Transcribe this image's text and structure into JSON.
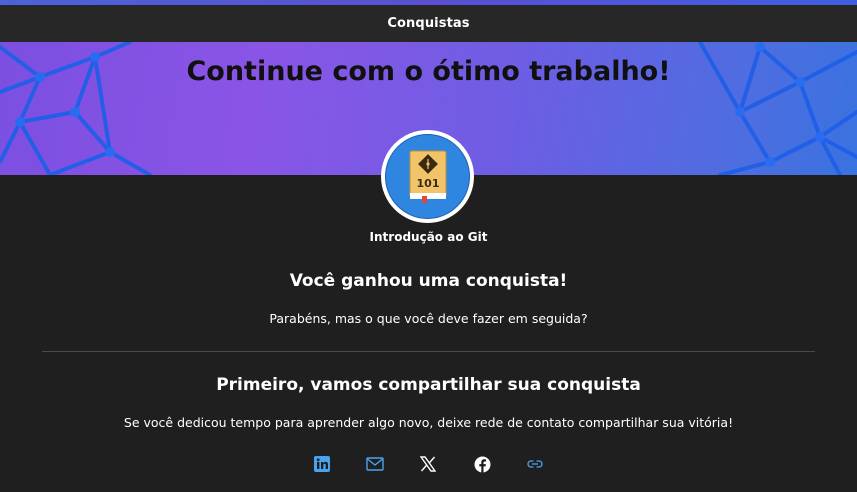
{
  "window": {
    "title": "Conquistas"
  },
  "banner": {
    "heading": "Continue com o ótimo trabalho!"
  },
  "badge": {
    "icon": "git-book-101-icon",
    "icon_text": "101",
    "title": "Introdução ao Git"
  },
  "earned": {
    "heading": "Você ganhou uma conquista!",
    "text": "Parabéns, mas o que você deve fazer em seguida?"
  },
  "share": {
    "heading": "Primeiro, vamos compartilhar sua conquista",
    "text": "Se você dedicou tempo para aprender algo novo, deixe rede de contato compartilhar sua vitória!",
    "buttons": [
      {
        "name": "linkedin",
        "icon": "linkedin-icon"
      },
      {
        "name": "email",
        "icon": "mail-icon"
      },
      {
        "name": "x",
        "icon": "x-icon"
      },
      {
        "name": "facebook",
        "icon": "facebook-icon"
      },
      {
        "name": "copy-link",
        "icon": "link-icon"
      }
    ]
  },
  "colors": {
    "background": "#1f1f1f",
    "titlebar": "#272727",
    "banner_start": "#7b4fe0",
    "banner_end": "#3a72e0",
    "badge_blue": "#2f86e0",
    "link_blue": "#4aa3f0"
  }
}
